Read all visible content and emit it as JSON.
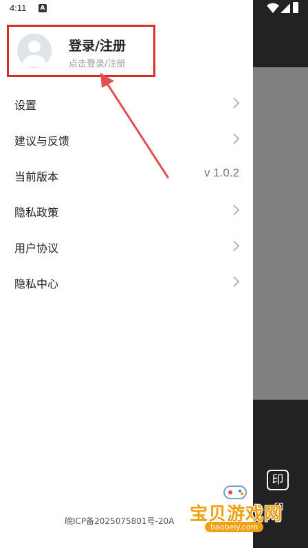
{
  "status_bar": {
    "time": "4:11",
    "notification_icon": "a-icon"
  },
  "profile": {
    "title": "登录/注册",
    "subtitle": "点击登录/注册",
    "avatar_icon": "user-avatar-icon"
  },
  "menu": {
    "items": [
      {
        "label": "设置",
        "type": "chevron"
      },
      {
        "label": "建议与反馈",
        "type": "chevron"
      },
      {
        "label": "当前版本",
        "type": "value",
        "value": "v 1.0.2"
      },
      {
        "label": "隐私政策",
        "type": "chevron"
      },
      {
        "label": "用户协议",
        "type": "chevron"
      },
      {
        "label": "隐私中心",
        "type": "chevron"
      }
    ]
  },
  "footer": {
    "icp": "皖ICP备2025075801号-20A"
  },
  "background": {
    "print_icon_glyph": "印",
    "print_label": "印"
  },
  "watermark": {
    "brand": "宝贝游戏网",
    "url": "baobeiy.com"
  },
  "colors": {
    "highlight": "#d62c2c",
    "watermark": "#f0a010"
  }
}
